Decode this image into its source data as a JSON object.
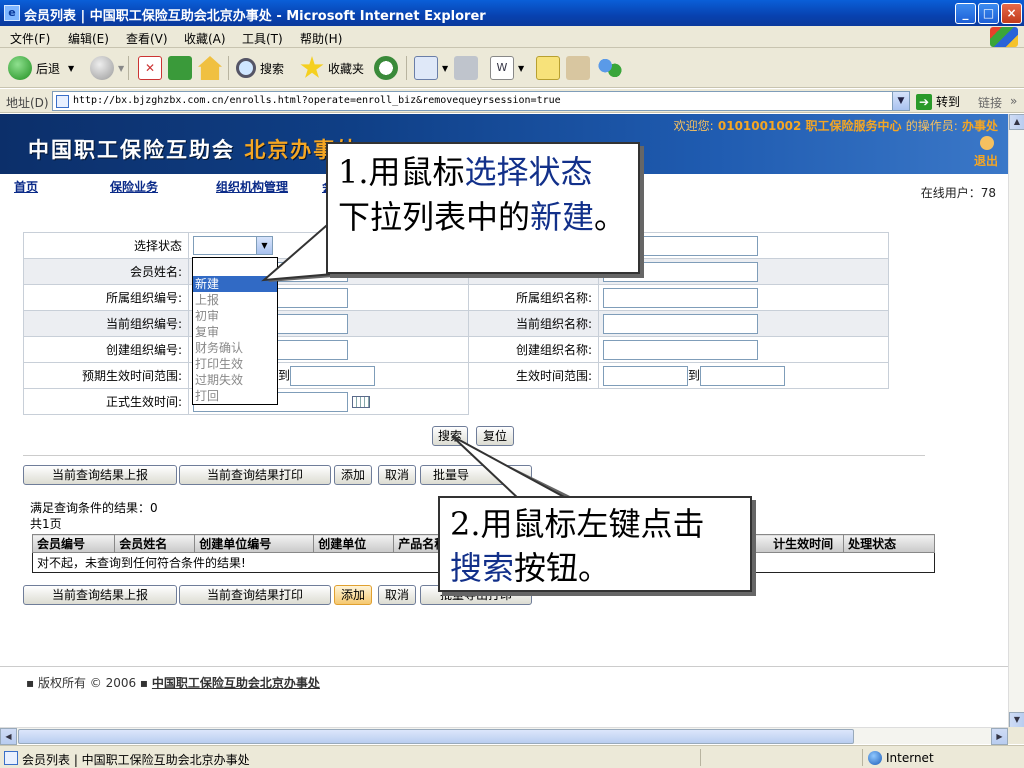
{
  "window": {
    "title": "会员列表 | 中国职工保险互助会北京办事处 - Microsoft Internet Explorer",
    "controls": [
      "_",
      "□",
      "×"
    ]
  },
  "menu": [
    "文件(F)",
    "编辑(E)",
    "查看(V)",
    "收藏(A)",
    "工具(T)",
    "帮助(H)"
  ],
  "toolbar": {
    "back": "后退",
    "search": "搜索",
    "favorites": "收藏夹"
  },
  "address": {
    "label": "地址(D)",
    "url": "http://bx.bjzghzbx.com.cn/enrolls.html?operate=enroll_biz&removequeyrsession=true",
    "go": "转到",
    "links": "链接"
  },
  "banner": {
    "logo_a": "中国职工保险互助会",
    "logo_b": "北京办事处",
    "welcome_prefix": "欢迎您:",
    "welcome_user": "0101001002 职工保险服务中心",
    "operator_label": "的操作员:",
    "operator": "办事处",
    "logout": "退出"
  },
  "nav": {
    "items": [
      "首页",
      "保险业务",
      "组织机构管理",
      "会"
    ],
    "online": "在线用户：78"
  },
  "form": {
    "status_label": "选择状态",
    "member_name_label": "会员姓名:",
    "org_code_label": "所属组织编号:",
    "org_name_label": "所属组织名称:",
    "cur_org_code_label": "当前组织编号:",
    "cur_org_name_label": "当前组织名称:",
    "create_org_code_label": "创建组织编号:",
    "create_org_name_label": "创建组织名称:",
    "expected_range_label": "预期生效时间范围:",
    "effective_range_label": "生效时间范围:",
    "formal_time_label": "正式生效时间:",
    "to": "到",
    "status_options": [
      "新建",
      "上报",
      "初审",
      "复审",
      "财务确认",
      "打印生效",
      "过期失效",
      "打回"
    ],
    "selected_option": "新建"
  },
  "buttons": {
    "search": "搜索",
    "reset": "复位",
    "report": "当前查询结果上报",
    "print": "当前查询结果打印",
    "add": "添加",
    "cancel": "取消",
    "batch_top": "批量导",
    "batch_bottom": "批量导出打印"
  },
  "results": {
    "count_text": "满足查询条件的结果：0",
    "pages_text": "共1页",
    "headers": [
      "会员编号",
      "会员姓名",
      "创建单位编号",
      "创建单位",
      "产品名称",
      "计生效时间",
      "处理状态"
    ],
    "empty": "对不起，未查询到任何符合条件的结果!"
  },
  "footer": {
    "copyright": "▪ 版权所有 © 2006 ▪",
    "org": "中国职工保险互助会北京办事处"
  },
  "status": {
    "page": "会员列表 | 中国职工保险互助会北京办事处",
    "zone": "Internet"
  },
  "callouts": {
    "c1_line1_a": "1.用鼠标",
    "c1_line1_b": "选择状态",
    "c1_line2_a": "下拉列表中的",
    "c1_line2_b": "新建",
    "c1_line2_c": "。",
    "c2_line1": "2.用鼠标左键点击",
    "c2_line2_a": "搜索",
    "c2_line2_b": "按钮。"
  }
}
